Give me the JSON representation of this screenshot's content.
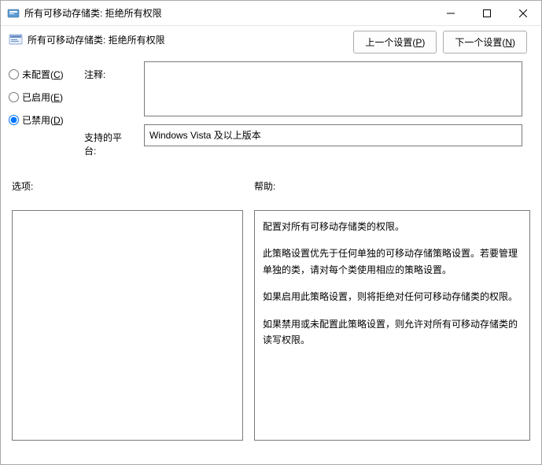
{
  "title": "所有可移动存储类: 拒绝所有权限",
  "subtitle": "所有可移动存储类: 拒绝所有权限",
  "nav": {
    "prev": "上一个设置(P)",
    "next": "下一个设置(N)"
  },
  "radios": {
    "not_configured": "未配置(C)",
    "enabled": "已启用(E)",
    "disabled": "已禁用(D)",
    "selected": "disabled"
  },
  "labels": {
    "comment": "注释:",
    "platform": "支持的平台:",
    "options": "选项:",
    "help": "帮助:"
  },
  "comment_value": "",
  "platform_value": "Windows Vista 及以上版本",
  "help_paragraphs": [
    "配置对所有可移动存储类的权限。",
    "此策略设置优先于任何单独的可移动存储策略设置。若要管理单独的类，请对每个类使用相应的策略设置。",
    "如果启用此策略设置，则将拒绝对任何可移动存储类的权限。",
    "如果禁用或未配置此策略设置，则允许对所有可移动存储类的读写权限。"
  ]
}
